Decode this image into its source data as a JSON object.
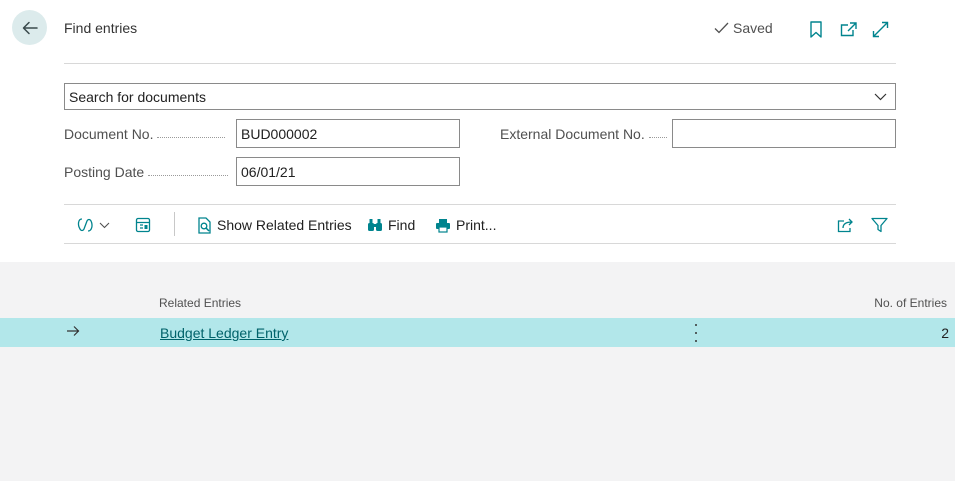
{
  "header": {
    "title": "Find entries",
    "saved_label": "Saved"
  },
  "search": {
    "selected": "Search for documents"
  },
  "fields": {
    "document_no_label": "Document No.",
    "document_no_value": "BUD000002",
    "posting_date_label": "Posting Date",
    "posting_date_value": "06/01/21",
    "external_doc_label": "External Document No.",
    "external_doc_value": ""
  },
  "toolbar": {
    "show_related_label": "Show Related Entries",
    "find_label": "Find",
    "print_label": "Print..."
  },
  "table": {
    "columns": [
      "Related Entries",
      "No. of Entries"
    ],
    "rows": [
      {
        "related_entries": "Budget Ledger Entry",
        "no_of_entries": "2"
      }
    ]
  },
  "colors": {
    "accent": "#00848e",
    "selected_row": "#b2e7ea",
    "back_button_bg": "#dcebec"
  },
  "icons": [
    "back-arrow-icon",
    "checkmark-icon",
    "bookmark-icon",
    "open-new-window-icon",
    "expand-icon",
    "chevron-down-icon",
    "copilot-icon",
    "page-layout-icon",
    "document-search-icon",
    "binoculars-icon",
    "printer-icon",
    "share-icon",
    "filter-icon",
    "row-arrow-icon",
    "more-options-icon"
  ]
}
